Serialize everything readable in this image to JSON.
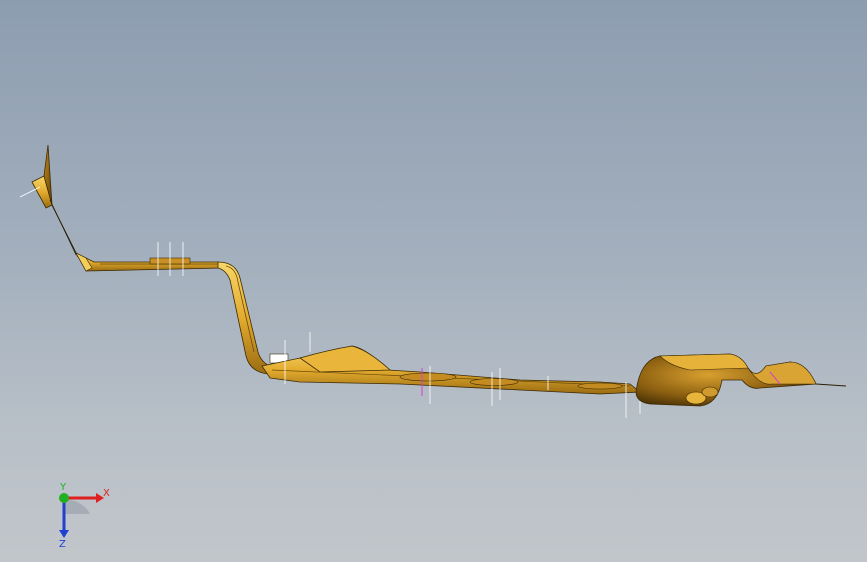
{
  "viewport": {
    "background_top": "#8d9db0",
    "background_bottom": "#c2c6cb"
  },
  "model": {
    "part_color": "#e8b43a",
    "part_dark": "#8a6110",
    "part_edge": "#3b2a05"
  },
  "triad": {
    "x_label": "X",
    "y_label": "Y",
    "z_label": "Z",
    "x_color": "#e02020",
    "y_color": "#20b020",
    "z_color": "#2040d0"
  }
}
